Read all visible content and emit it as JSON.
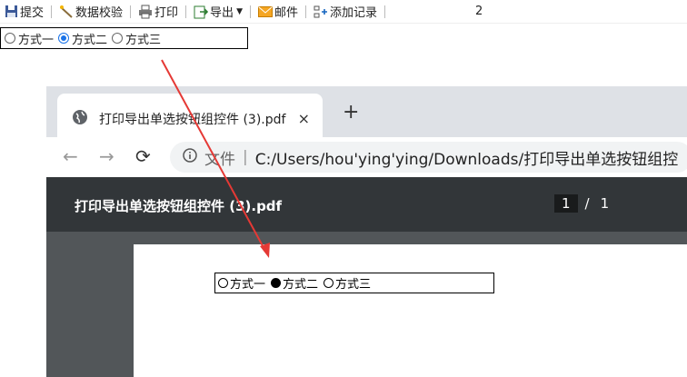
{
  "toolbar": {
    "items": [
      {
        "label": "提交",
        "icon": "save-icon"
      },
      {
        "label": "数据校验",
        "icon": "wand-icon"
      },
      {
        "label": "打印",
        "icon": "printer-icon"
      },
      {
        "label": "导出",
        "icon": "export-icon"
      },
      {
        "label": "邮件",
        "icon": "mail-icon"
      },
      {
        "label": "添加记录",
        "icon": "add-record-icon"
      }
    ],
    "page_number": "2"
  },
  "radio_group": {
    "options": [
      "方式一",
      "方式二",
      "方式三"
    ],
    "selected": "方式二"
  },
  "browser": {
    "tab_title": "打印导出单选按钮组控件 (3).pdf",
    "tab_close": "×",
    "new_tab": "+",
    "address_scheme": "文件",
    "address_sep": "|",
    "address_url": "C:/Users/hou'ying'ying/Downloads/打印导出单选按钮组控",
    "pdf_title": "打印导出单选按钮组控件 (3).pdf",
    "pdf_current_page": "1",
    "pdf_page_sep": "/",
    "pdf_total_pages": "1",
    "pdf_radio_options": [
      "方式一",
      "方式二",
      "方式三"
    ],
    "pdf_radio_selected": "方式二"
  },
  "colors": {
    "accent": "#1a73e8",
    "arrow": "#e53935",
    "pdf_toolbar": "#323639"
  }
}
